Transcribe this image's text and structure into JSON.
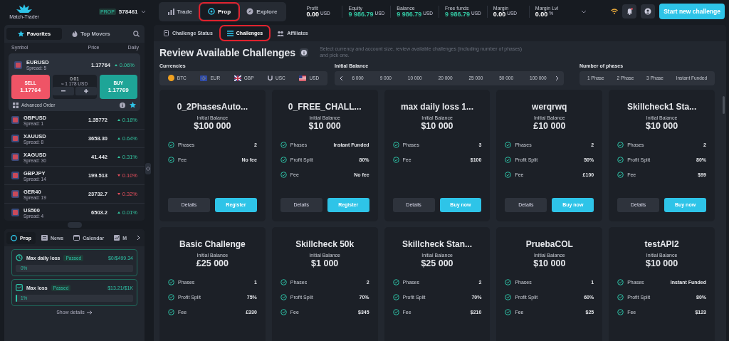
{
  "logo": {
    "text": "Match-Trader"
  },
  "account": {
    "badge": "PROP",
    "number": "578461"
  },
  "nav_tabs": [
    {
      "label": "Trade",
      "selected": false,
      "highlighted": false
    },
    {
      "label": "Prop",
      "selected": true,
      "highlighted": true
    },
    {
      "label": "Explore",
      "selected": false,
      "highlighted": false
    }
  ],
  "stats": [
    {
      "label": "Profit",
      "value": "0.00",
      "unit": "USD",
      "positive": false
    },
    {
      "label": "Equity",
      "value": "9 986.79",
      "unit": "USD",
      "positive": true
    },
    {
      "label": "Balance",
      "value": "9 986.79",
      "unit": "USD",
      "positive": true
    },
    {
      "label": "Free funds",
      "value": "9 986.79",
      "unit": "USD",
      "positive": true
    },
    {
      "label": "Margin",
      "value": "0.00",
      "unit": "USD",
      "positive": false
    },
    {
      "label": "Margin Lvl",
      "value": "0.00",
      "unit": "%",
      "positive": false
    }
  ],
  "start_button": "Start new challenge",
  "watchlist": {
    "tabs": [
      {
        "label": "Favorites",
        "selected": true
      },
      {
        "label": "Top Movers",
        "selected": false
      }
    ],
    "columns": [
      "Symbol",
      "Price",
      "Daily"
    ],
    "expanded": {
      "symbol": "EURUSD",
      "spread": "Spread: 5",
      "price": "1.17764",
      "change": "0.06%",
      "rising": true,
      "sell_label": "SELL",
      "sell_price": "1.17764",
      "volume": "0.01",
      "volume_value": "≈ 1 178 USD",
      "buy_label": "BUY",
      "buy_price": "1.17769",
      "advanced": "Advanced Order"
    },
    "rows": [
      {
        "symbol": "GBPUSD",
        "spread": "Spread: 1",
        "price": "1.35772",
        "change": "0.18%",
        "rising": true
      },
      {
        "symbol": "XAUUSD",
        "spread": "Spread: 8",
        "price": "3658.30",
        "change": "0.64%",
        "rising": true
      },
      {
        "symbol": "XAGUSD",
        "spread": "Spread: 30",
        "price": "41.442",
        "change": "0.31%",
        "rising": true
      },
      {
        "symbol": "GBPJPY",
        "spread": "Spread: 14",
        "price": "199.513",
        "change": "0.10%",
        "rising": false
      },
      {
        "symbol": "GER40",
        "spread": "Spread: 19",
        "price": "23732.7",
        "change": "0.32%",
        "rising": false
      },
      {
        "symbol": "US500",
        "spread": "Spread: 4",
        "price": "6503.2",
        "change": "0.01%",
        "rising": true
      }
    ]
  },
  "lower_panel": {
    "tabs": [
      {
        "label": "Prop",
        "selected": true
      },
      {
        "label": "News",
        "selected": false
      },
      {
        "label": "Calendar",
        "selected": false
      },
      {
        "label": "M",
        "selected": false
      }
    ],
    "limits": [
      {
        "title": "Max daily loss",
        "status": "Passed",
        "amount": "$0/$499.34",
        "percent": "0%",
        "level": 0
      },
      {
        "title": "Max loss",
        "status": "Passed",
        "amount": "$13.21/$1K",
        "percent": "1%",
        "level": 0.01
      }
    ],
    "show_details": "Show details"
  },
  "main_tabs": [
    {
      "label": "Challenge Status",
      "selected": false,
      "highlighted": false
    },
    {
      "label": "Challenges",
      "selected": true,
      "highlighted": true
    },
    {
      "label": "Affiliates",
      "selected": false,
      "highlighted": false
    }
  ],
  "title": "Review Available Challenges",
  "description": "Select currency and account size, review available challenges (including number of phases) and pick one.",
  "filters": {
    "currencies": {
      "label": "Currencies",
      "options": [
        "BTC",
        "EUR",
        "GBP",
        "USC",
        "USD"
      ]
    },
    "initial_balance": {
      "label": "Initial Balance",
      "options": [
        "6 000",
        "9 000",
        "10 000",
        "20 000",
        "25 000",
        "50 000",
        "100 000"
      ]
    },
    "phases": {
      "label": "Number of phases",
      "options": [
        "1 Phase",
        "2 Phase",
        "3 Phase",
        "Instant Funded"
      ]
    }
  },
  "challenges": [
    {
      "name": "0_2PhasesAuto...",
      "balance_label": "Initial Balance",
      "balance": "$100 000",
      "features": [
        {
          "label": "Phases",
          "value": "2"
        },
        {
          "label": "Fee",
          "value": "No fee"
        }
      ],
      "buttons": [
        {
          "label": "Details",
          "kind": "secondary"
        },
        {
          "label": "Register",
          "kind": "primary"
        }
      ]
    },
    {
      "name": "0_FREE_CHALL...",
      "balance_label": "Initial Balance",
      "balance": "$10 000",
      "features": [
        {
          "label": "Phases",
          "value": "Instant Funded"
        },
        {
          "label": "Profit Split",
          "value": "80%"
        },
        {
          "label": "Fee",
          "value": "No fee"
        }
      ],
      "buttons": [
        {
          "label": "Details",
          "kind": "secondary"
        },
        {
          "label": "Register",
          "kind": "primary"
        }
      ]
    },
    {
      "name": "max daily loss 1...",
      "balance_label": "Initial Balance",
      "balance": "$10 000",
      "features": [
        {
          "label": "Phases",
          "value": "3"
        },
        {
          "label": "Fee",
          "value": "$100"
        }
      ],
      "buttons": [
        {
          "label": "Details",
          "kind": "secondary"
        },
        {
          "label": "Buy now",
          "kind": "primary"
        }
      ]
    },
    {
      "name": "werqrwq",
      "balance_label": "Initial Balance",
      "balance": "£10 000",
      "features": [
        {
          "label": "Phases",
          "value": "2"
        },
        {
          "label": "Profit Split",
          "value": "50%"
        },
        {
          "label": "Fee",
          "value": "£100"
        }
      ],
      "buttons": [
        {
          "label": "Details",
          "kind": "secondary"
        },
        {
          "label": "Buy now",
          "kind": "primary"
        }
      ]
    },
    {
      "name": "Skillcheck1 Sta...",
      "balance_label": "Initial Balance",
      "balance": "$10 000",
      "features": [
        {
          "label": "Phases",
          "value": "2"
        },
        {
          "label": "Profit Split",
          "value": "80%"
        },
        {
          "label": "Fee",
          "value": "$99"
        }
      ],
      "buttons": [
        {
          "label": "Details",
          "kind": "secondary"
        },
        {
          "label": "Buy now",
          "kind": "primary"
        }
      ]
    },
    {
      "name": "Basic Challenge",
      "balance_label": "Initial Balance",
      "balance": "£25 000",
      "features": [
        {
          "label": "Phases",
          "value": "1"
        },
        {
          "label": "Profit Split",
          "value": "75%"
        },
        {
          "label": "Fee",
          "value": "£330"
        }
      ]
    },
    {
      "name": "Skillcheck 50k",
      "balance_label": "Initial Balance",
      "balance": "$1 000",
      "features": [
        {
          "label": "Phases",
          "value": "2"
        },
        {
          "label": "Profit Split",
          "value": "70%"
        },
        {
          "label": "Fee",
          "value": "$345"
        }
      ]
    },
    {
      "name": "Skillcheck Stan...",
      "balance_label": "Initial Balance",
      "balance": "$25 000",
      "features": [
        {
          "label": "Phases",
          "value": "2"
        },
        {
          "label": "Profit Split",
          "value": "70%"
        },
        {
          "label": "Fee",
          "value": "$210"
        }
      ]
    },
    {
      "name": "PruebaCOL",
      "balance_label": "Initial Balance",
      "balance": "$10 000",
      "features": [
        {
          "label": "Phases",
          "value": "1"
        },
        {
          "label": "Profit Split",
          "value": "60%"
        },
        {
          "label": "Fee",
          "value": "$25"
        }
      ]
    },
    {
      "name": "testAPI2",
      "balance_label": "Initial Balance",
      "balance": "$10 000",
      "features": [
        {
          "label": "Phases",
          "value": "Instant Funded"
        },
        {
          "label": "Profit Split",
          "value": "80%"
        },
        {
          "label": "Fee",
          "value": "$123"
        }
      ]
    }
  ]
}
